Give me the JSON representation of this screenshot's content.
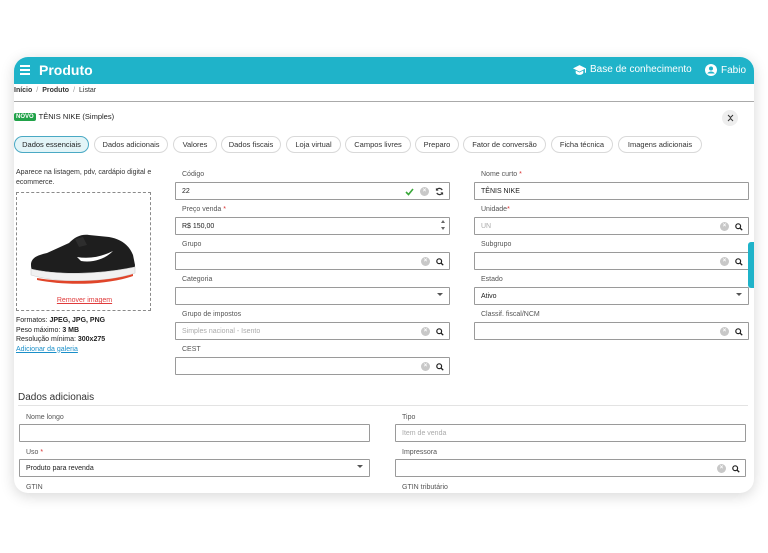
{
  "app": {
    "title": "Produto",
    "knowledge_base": "Base de conhecimento",
    "user": "Fabio"
  },
  "breadcrumb": [
    "Início",
    "Produto",
    "Listar"
  ],
  "product": {
    "badge": "NOVO",
    "name": "TÊNIS NIKE (Simples)"
  },
  "tabs": [
    "Dados essenciais",
    "Dados adicionais",
    "Valores",
    "Dados fiscais",
    "Loja virtual",
    "Campos livres",
    "Preparo",
    "Fator de conversão",
    "Ficha técnica",
    "Imagens adicionais"
  ],
  "active_tab": "Dados essenciais",
  "image_panel": {
    "note": "Aparece na listagem, pdv, cardápio digital e ecommerce.",
    "remove_label": "Remover imagem",
    "formats_label": "Formatos:",
    "formats_value": "JPEG, JPG, PNG",
    "max_weight_label": "Peso máximo:",
    "max_weight_value": "3 MB",
    "min_res_label": "Resolução mínima:",
    "min_res_value": "300x275",
    "gallery_link": "Adicionar da galeria"
  },
  "fields": {
    "codigo": {
      "label": "Código",
      "value": "22"
    },
    "nome_curto": {
      "label": "Nome curto",
      "value": "TÊNIS NIKE"
    },
    "preco_venda": {
      "label": "Preço venda",
      "value": "R$ 150,00"
    },
    "unidade": {
      "label": "Unidade",
      "placeholder": "UN"
    },
    "grupo": {
      "label": "Grupo",
      "value": ""
    },
    "subgrupo": {
      "label": "Subgrupo",
      "value": ""
    },
    "categoria": {
      "label": "Categoria",
      "value": ""
    },
    "estado": {
      "label": "Estado",
      "value": "Ativo"
    },
    "grupo_impostos": {
      "label": "Grupo de impostos",
      "placeholder": "Simples nacional - Isento"
    },
    "classif_fiscal": {
      "label": "Classif. fiscal/NCM",
      "value": ""
    },
    "cest": {
      "label": "CEST",
      "value": ""
    }
  },
  "dados_adicionais": {
    "title": "Dados adicionais",
    "nome_longo": {
      "label": "Nome longo",
      "value": ""
    },
    "tipo": {
      "label": "Tipo",
      "placeholder": "Item de venda"
    },
    "uso": {
      "label": "Uso",
      "value": "Produto para revenda"
    },
    "impressora": {
      "label": "Impressora",
      "value": ""
    },
    "gtin": {
      "label": "GTIN"
    },
    "gtin_tributario": {
      "label": "GTIN tributário"
    }
  },
  "colors": {
    "brand": "#1fb3c9",
    "badge_green": "#21a249",
    "required_red": "#d93030",
    "link_blue": "#1a8fc9"
  },
  "icons": [
    "menu-icon",
    "graduation-cap-icon",
    "user-icon",
    "collapse-icon",
    "check-icon",
    "clear-icon",
    "refresh-icon",
    "search-icon",
    "chevron-down-icon"
  ]
}
